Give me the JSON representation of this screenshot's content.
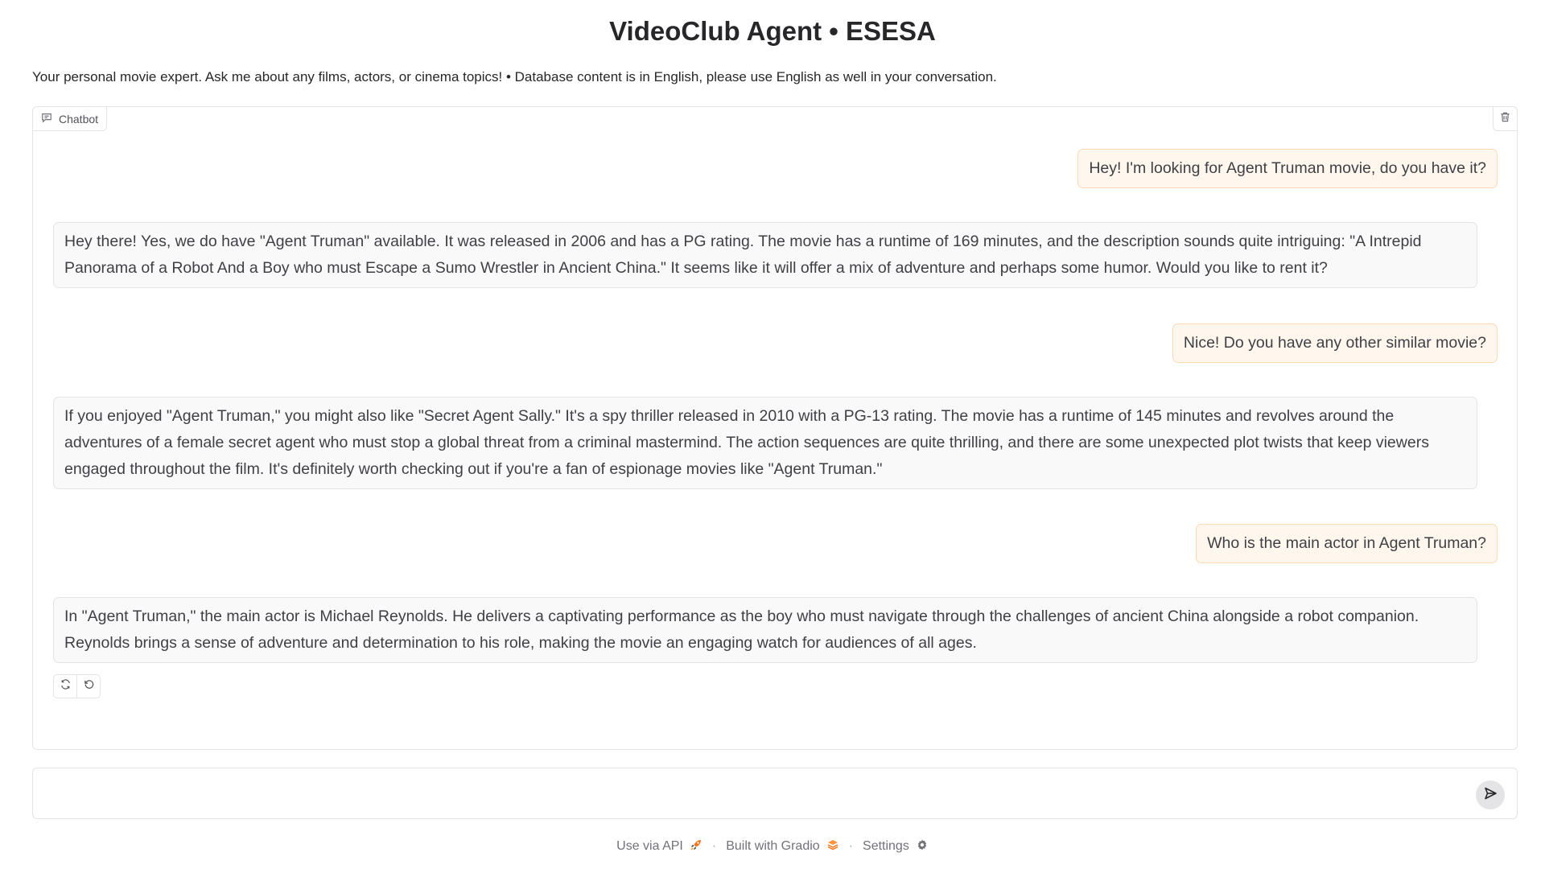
{
  "header": {
    "title": "VideoClub Agent • ESESA",
    "description": "Your personal movie expert. Ask me about any films, actors, or cinema topics! • Database content is in English, please use English as well in your conversation."
  },
  "chatbot": {
    "label": "Chatbot",
    "label_icon": "chat-icon",
    "clear_icon": "trash-icon",
    "messages": [
      {
        "role": "user",
        "text": "Hey! I'm looking for Agent Truman movie, do you have it?"
      },
      {
        "role": "bot",
        "text": "Hey there! Yes, we do have \"Agent Truman\" available. It was released in 2006 and has a PG rating. The movie has a runtime of 169 minutes, and the description sounds quite intriguing: \"A Intrepid Panorama of a Robot And a Boy who must Escape a Sumo Wrestler in Ancient China.\" It seems like it will offer a mix of adventure and perhaps some humor. Would you like to rent it?"
      },
      {
        "role": "user",
        "text": "Nice! Do you have any other similar movie?"
      },
      {
        "role": "bot",
        "text": "If you enjoyed \"Agent Truman,\" you might also like \"Secret Agent Sally.\" It's a spy thriller released in 2010 with a PG-13 rating. The movie has a runtime of 145 minutes and revolves around the adventures of a female secret agent who must stop a global threat from a criminal mastermind. The action sequences are quite thrilling, and there are some unexpected plot twists that keep viewers engaged throughout the film. It's definitely worth checking out if you're a fan of espionage movies like \"Agent Truman.\""
      },
      {
        "role": "user",
        "text": "Who is the main actor in Agent Truman?"
      },
      {
        "role": "bot",
        "text": "In \"Agent Truman,\" the main actor is Michael Reynolds. He delivers a captivating performance as the boy who must navigate through the challenges of ancient China alongside a robot companion. Reynolds brings a sense of adventure and determination to his role, making the movie an engaging watch for audiences of all ages."
      }
    ],
    "actions": {
      "retry_icon": "retry-icon",
      "undo_icon": "undo-icon"
    }
  },
  "input": {
    "value": "",
    "placeholder": "",
    "send_icon": "send-icon"
  },
  "footer": {
    "api_label": "Use via API",
    "api_icon": "rocket-icon",
    "built_label": "Built with Gradio",
    "built_icon": "gradio-logo-icon",
    "settings_label": "Settings",
    "settings_icon": "gear-icon",
    "separator": "·"
  },
  "colors": {
    "user_bubble_bg": "#fff7ed",
    "user_bubble_border": "#fcd9b6",
    "bot_bubble_bg": "#f9f9f9",
    "border": "#e4e4e7",
    "gradio_orange": "#f97316"
  }
}
